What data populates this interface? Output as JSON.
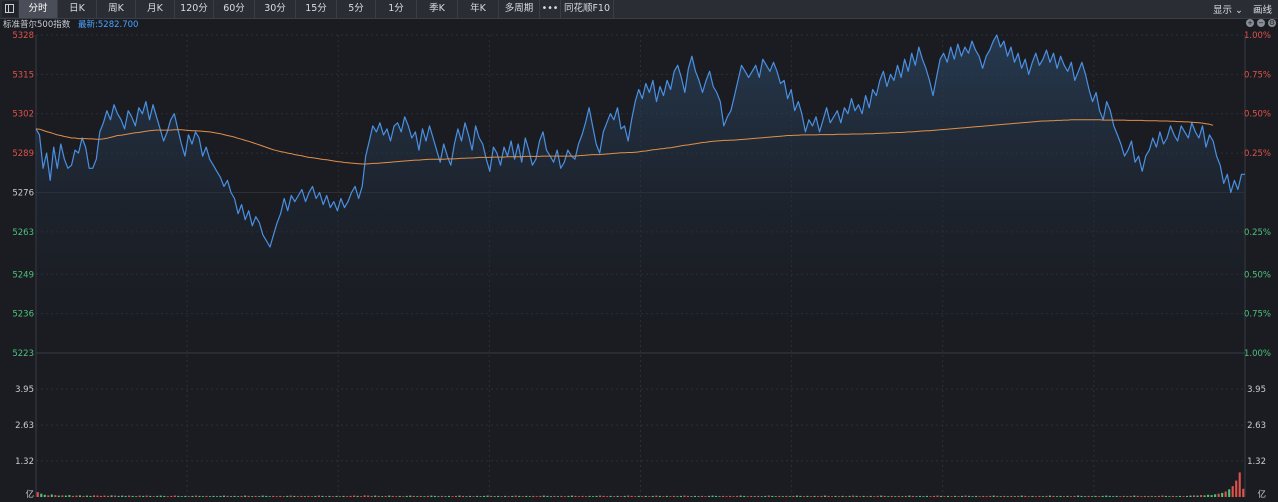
{
  "toolbar": {
    "tabs": [
      "分时",
      "日K",
      "周K",
      "月K",
      "120分",
      "60分",
      "30分",
      "15分",
      "5分",
      "1分",
      "季K",
      "年K",
      "多周期",
      "•••",
      "同花顺F10"
    ],
    "active_tab": "分时",
    "display_label": "显示",
    "draw_label": "画线"
  },
  "info": {
    "index_name": "标准普尔500指数",
    "latest_label": "最新:",
    "latest_value": "5282.700"
  },
  "colors": {
    "price_line": "#4a90e2",
    "avg_line": "#e0904a",
    "up": "#e0524a",
    "down": "#4ec27a",
    "background": "#1a1c22",
    "grid": "#2c2f36"
  },
  "chart_data": {
    "type": "line",
    "price_axis": {
      "ticks": [
        "5328",
        "5315",
        "5302",
        "5289",
        "5276",
        "5263",
        "5249",
        "5236",
        "5223"
      ],
      "pct_ticks": [
        "1.00%",
        "0.75%",
        "0.50%",
        "0.25%",
        "",
        "0.25%",
        "0.50%",
        "0.75%",
        "1.00%"
      ],
      "ylim": [
        5223,
        5328
      ],
      "reference": 5276
    },
    "volume_axis": {
      "ticks": [
        "3.95",
        "2.63",
        "1.32",
        "亿"
      ],
      "unit": "亿",
      "ylim": [
        0,
        5.27
      ]
    },
    "series": [
      {
        "values": [
          5297,
          5295,
          5284,
          5289,
          5280,
          5291,
          5284,
          5292,
          5287,
          5284,
          5285,
          5290,
          5289,
          5294,
          5291,
          5284,
          5284,
          5287,
          5296,
          5299,
          5303,
          5300,
          5305,
          5302,
          5300,
          5297,
          5303,
          5301,
          5298,
          5304,
          5302,
          5306,
          5300,
          5305,
          5301,
          5297,
          5293,
          5296,
          5300,
          5302,
          5297,
          5292,
          5288,
          5295,
          5292,
          5296,
          5294,
          5288,
          5291,
          5287,
          5285,
          5283,
          5281,
          5278,
          5280,
          5276,
          5274,
          5269,
          5272,
          5267,
          5270,
          5265,
          5268,
          5266,
          5262,
          5260,
          5258,
          5262,
          5266,
          5269,
          5274,
          5270,
          5275,
          5273,
          5275,
          5277,
          5273,
          5276,
          5278,
          5274,
          5276,
          5272,
          5275,
          5271,
          5273,
          5270,
          5274,
          5271,
          5273,
          5276,
          5278,
          5274,
          5278,
          5288,
          5293,
          5298,
          5296,
          5299,
          5295,
          5297,
          5293,
          5298,
          5299,
          5296,
          5301,
          5298,
          5294,
          5296,
          5290,
          5297,
          5293,
          5298,
          5294,
          5290,
          5286,
          5292,
          5288,
          5285,
          5292,
          5297,
          5293,
          5299,
          5295,
          5290,
          5298,
          5294,
          5292,
          5287,
          5283,
          5291,
          5289,
          5285,
          5291,
          5288,
          5293,
          5287,
          5292,
          5286,
          5294,
          5290,
          5285,
          5287,
          5293,
          5296,
          5290,
          5288,
          5286,
          5290,
          5284,
          5286,
          5290,
          5288,
          5287,
          5292,
          5295,
          5299,
          5304,
          5298,
          5292,
          5289,
          5296,
          5299,
          5302,
          5300,
          5304,
          5297,
          5298,
          5293,
          5300,
          5306,
          5310,
          5307,
          5312,
          5309,
          5313,
          5306,
          5311,
          5308,
          5313,
          5310,
          5316,
          5318,
          5314,
          5309,
          5317,
          5321,
          5316,
          5313,
          5309,
          5313,
          5316,
          5311,
          5309,
          5306,
          5298,
          5301,
          5303,
          5308,
          5313,
          5318,
          5316,
          5314,
          5316,
          5318,
          5314,
          5320,
          5318,
          5316,
          5319,
          5316,
          5312,
          5313,
          5307,
          5310,
          5303,
          5306,
          5302,
          5296,
          5300,
          5298,
          5301,
          5296,
          5300,
          5304,
          5299,
          5301,
          5303,
          5299,
          5304,
          5302,
          5307,
          5303,
          5305,
          5302,
          5308,
          5304,
          5310,
          5308,
          5313,
          5316,
          5311,
          5315,
          5313,
          5318,
          5314,
          5320,
          5316,
          5322,
          5318,
          5324,
          5320,
          5317,
          5313,
          5308,
          5314,
          5320,
          5322,
          5319,
          5324,
          5320,
          5325,
          5321,
          5324,
          5322,
          5326,
          5323,
          5321,
          5317,
          5321,
          5323,
          5326,
          5328,
          5324,
          5326,
          5321,
          5324,
          5319,
          5322,
          5317,
          5320,
          5315,
          5319,
          5322,
          5318,
          5320,
          5323,
          5319,
          5322,
          5317,
          5321,
          5318,
          5316,
          5319,
          5313,
          5316,
          5319,
          5315,
          5310,
          5306,
          5309,
          5303,
          5300,
          5306,
          5303,
          5298,
          5295,
          5292,
          5288,
          5290,
          5293,
          5286,
          5288,
          5283,
          5288,
          5290,
          5294,
          5291,
          5296,
          5292,
          5294,
          5298,
          5295,
          5293,
          5298,
          5296,
          5294,
          5299,
          5296,
          5294,
          5298,
          5291,
          5295,
          5293,
          5288,
          5285,
          5279,
          5282,
          5276,
          5280,
          5277,
          5282,
          5282
        ]
      },
      {
        "values": [
          5297.0,
          5296.9,
          5296.5,
          5296.1,
          5295.8,
          5295.4,
          5295.0,
          5294.8,
          5294.5,
          5294.3,
          5294.0,
          5294.0,
          5293.8,
          5293.8,
          5293.8,
          5293.7,
          5293.7,
          5293.6,
          5293.6,
          5293.7,
          5293.9,
          5294.2,
          5294.5,
          5294.8,
          5294.9,
          5295.1,
          5295.3,
          5295.5,
          5295.7,
          5295.8,
          5296.0,
          5296.2,
          5296.4,
          5296.5,
          5296.6,
          5296.6,
          5296.6,
          5296.6,
          5296.6,
          5296.7,
          5296.7,
          5296.7,
          5296.6,
          5296.5,
          5296.4,
          5296.4,
          5296.3,
          5296.2,
          5296.1,
          5296.0,
          5295.8,
          5295.6,
          5295.4,
          5295.1,
          5294.8,
          5294.6,
          5294.3,
          5293.9,
          5293.6,
          5293.2,
          5292.9,
          5292.5,
          5292.1,
          5291.7,
          5291.3,
          5290.9,
          5290.5,
          5290.1,
          5289.8,
          5289.5,
          5289.3,
          5289.0,
          5288.8,
          5288.5,
          5288.3,
          5288.1,
          5287.8,
          5287.6,
          5287.5,
          5287.3,
          5287.1,
          5286.9,
          5286.8,
          5286.6,
          5286.4,
          5286.2,
          5286.1,
          5285.9,
          5285.8,
          5285.7,
          5285.6,
          5285.5,
          5285.4,
          5285.4,
          5285.5,
          5285.6,
          5285.6,
          5285.7,
          5285.8,
          5285.9,
          5286.0,
          5286.1,
          5286.2,
          5286.3,
          5286.4,
          5286.5,
          5286.6,
          5286.7,
          5286.7,
          5286.8,
          5286.9,
          5287.0,
          5287.0,
          5287.0,
          5287.0,
          5287.0,
          5287.1,
          5287.1,
          5287.1,
          5287.2,
          5287.3,
          5287.3,
          5287.4,
          5287.4,
          5287.5,
          5287.6,
          5287.6,
          5287.6,
          5287.6,
          5287.7,
          5287.7,
          5287.7,
          5287.7,
          5287.8,
          5287.8,
          5287.8,
          5287.8,
          5287.8,
          5287.9,
          5287.9,
          5287.9,
          5287.9,
          5287.9,
          5288.0,
          5288.0,
          5288.0,
          5288.0,
          5288.0,
          5288.0,
          5288.0,
          5288.0,
          5288.0,
          5288.0,
          5288.1,
          5288.2,
          5288.3,
          5288.4,
          5288.5,
          5288.5,
          5288.5,
          5288.6,
          5288.7,
          5288.8,
          5288.9,
          5289.0,
          5289.1,
          5289.1,
          5289.2,
          5289.2,
          5289.3,
          5289.4,
          5289.6,
          5289.7,
          5289.9,
          5290.1,
          5290.2,
          5290.4,
          5290.5,
          5290.7,
          5290.8,
          5291.0,
          5291.2,
          5291.4,
          5291.6,
          5291.7,
          5291.9,
          5292.1,
          5292.3,
          5292.5,
          5292.6,
          5292.8,
          5292.9,
          5293.0,
          5293.1,
          5293.2,
          5293.2,
          5293.3,
          5293.3,
          5293.4,
          5293.5,
          5293.6,
          5293.7,
          5293.8,
          5293.9,
          5294.0,
          5294.1,
          5294.2,
          5294.3,
          5294.4,
          5294.5,
          5294.6,
          5294.7,
          5294.8,
          5294.8,
          5294.9,
          5294.9,
          5295.0,
          5295.0,
          5295.0,
          5295.0,
          5295.0,
          5295.1,
          5295.1,
          5295.1,
          5295.1,
          5295.1,
          5295.2,
          5295.2,
          5295.2,
          5295.2,
          5295.3,
          5295.3,
          5295.3,
          5295.3,
          5295.4,
          5295.4,
          5295.4,
          5295.5,
          5295.5,
          5295.6,
          5295.6,
          5295.7,
          5295.7,
          5295.8,
          5295.8,
          5295.9,
          5296.0,
          5296.0,
          5296.1,
          5296.2,
          5296.3,
          5296.4,
          5296.4,
          5296.5,
          5296.6,
          5296.7,
          5296.8,
          5296.9,
          5297.0,
          5297.1,
          5297.2,
          5297.3,
          5297.4,
          5297.5,
          5297.6,
          5297.7,
          5297.8,
          5297.9,
          5298.0,
          5298.1,
          5298.2,
          5298.3,
          5298.4,
          5298.5,
          5298.6,
          5298.7,
          5298.8,
          5298.9,
          5299.0,
          5299.1,
          5299.2,
          5299.3,
          5299.4,
          5299.5,
          5299.6,
          5299.6,
          5299.7,
          5299.7,
          5299.8,
          5299.8,
          5299.9,
          5299.9,
          5300.0,
          5300.0,
          5300.0,
          5300.0,
          5300.0,
          5300.0,
          5300.0,
          5300.0,
          5300.0,
          5299.9,
          5299.9,
          5299.9,
          5299.9,
          5299.9,
          5299.9,
          5299.9,
          5299.8,
          5299.8,
          5299.8,
          5299.8,
          5299.8,
          5299.7,
          5299.7,
          5299.7,
          5299.7,
          5299.6,
          5299.6,
          5299.6,
          5299.5,
          5299.5,
          5299.4,
          5299.4,
          5299.3,
          5299.3,
          5299.2,
          5299.1,
          5299.0,
          5298.9,
          5298.7,
          5298.5,
          5298.2
        ]
      }
    ],
    "volume": [
      0.18,
      0.12,
      0.08,
      0.06,
      0.09,
      0.07,
      0.05,
      0.06,
      0.05,
      0.07,
      0.04,
      0.05,
      0.06,
      0.04,
      0.05,
      0.04,
      0.06,
      0.05,
      0.04,
      0.05,
      0.04,
      0.06,
      0.05,
      0.04,
      0.05,
      0.04,
      0.05,
      0.04,
      0.03,
      0.05,
      0.04,
      0.05,
      0.04,
      0.03,
      0.04,
      0.05,
      0.04,
      0.03,
      0.04,
      0.05,
      0.04,
      0.03,
      0.04,
      0.03,
      0.04,
      0.05,
      0.04,
      0.03,
      0.04,
      0.03,
      0.04,
      0.03,
      0.04,
      0.05,
      0.04,
      0.03,
      0.04,
      0.03,
      0.04,
      0.05,
      0.04,
      0.03,
      0.04,
      0.03,
      0.05,
      0.04,
      0.03,
      0.04,
      0.03,
      0.04,
      0.03,
      0.04,
      0.05,
      0.04,
      0.03,
      0.04,
      0.03,
      0.04,
      0.03,
      0.04,
      0.05,
      0.04,
      0.03,
      0.04,
      0.03,
      0.04,
      0.03,
      0.04,
      0.03,
      0.04,
      0.05,
      0.04,
      0.03,
      0.06,
      0.05,
      0.04,
      0.05,
      0.04,
      0.03,
      0.04,
      0.05,
      0.04,
      0.03,
      0.04,
      0.03,
      0.04,
      0.05,
      0.04,
      0.03,
      0.04,
      0.03,
      0.04,
      0.05,
      0.04,
      0.03,
      0.04,
      0.03,
      0.04,
      0.03,
      0.04,
      0.05,
      0.04,
      0.03,
      0.04,
      0.03,
      0.04,
      0.03,
      0.04,
      0.05,
      0.04,
      0.03,
      0.04,
      0.03,
      0.04,
      0.03,
      0.04,
      0.05,
      0.04,
      0.03,
      0.04,
      0.03,
      0.04,
      0.03,
      0.04,
      0.05,
      0.04,
      0.03,
      0.04,
      0.03,
      0.04,
      0.03,
      0.04,
      0.05,
      0.04,
      0.03,
      0.04,
      0.03,
      0.04,
      0.03,
      0.04,
      0.05,
      0.04,
      0.03,
      0.04,
      0.03,
      0.04,
      0.03,
      0.04,
      0.05,
      0.04,
      0.03,
      0.04,
      0.03,
      0.04,
      0.03,
      0.04,
      0.05,
      0.04,
      0.03,
      0.04,
      0.03,
      0.04,
      0.03,
      0.04,
      0.05,
      0.04,
      0.03,
      0.04,
      0.03,
      0.04,
      0.03,
      0.04,
      0.05,
      0.04,
      0.03,
      0.04,
      0.03,
      0.04,
      0.03,
      0.04,
      0.05,
      0.04,
      0.03,
      0.04,
      0.03,
      0.04,
      0.03,
      0.04,
      0.05,
      0.04,
      0.03,
      0.04,
      0.03,
      0.04,
      0.03,
      0.04,
      0.05,
      0.04,
      0.03,
      0.04,
      0.03,
      0.04,
      0.03,
      0.04,
      0.05,
      0.04,
      0.03,
      0.04,
      0.03,
      0.04,
      0.03,
      0.04,
      0.05,
      0.04,
      0.03,
      0.04,
      0.03,
      0.04,
      0.03,
      0.04,
      0.05,
      0.04,
      0.03,
      0.04,
      0.03,
      0.04,
      0.03,
      0.04,
      0.05,
      0.04,
      0.03,
      0.04,
      0.03,
      0.04,
      0.03,
      0.04,
      0.05,
      0.04,
      0.03,
      0.04,
      0.03,
      0.04,
      0.03,
      0.04,
      0.05,
      0.04,
      0.03,
      0.04,
      0.03,
      0.04,
      0.03,
      0.04,
      0.05,
      0.04,
      0.03,
      0.04,
      0.03,
      0.04,
      0.03,
      0.04,
      0.05,
      0.04,
      0.03,
      0.04,
      0.03,
      0.04,
      0.03,
      0.04,
      0.05,
      0.04,
      0.03,
      0.04,
      0.03,
      0.04,
      0.03,
      0.04,
      0.05,
      0.04,
      0.03,
      0.04,
      0.03,
      0.04,
      0.03,
      0.04,
      0.05,
      0.04,
      0.03,
      0.04,
      0.03,
      0.04,
      0.03,
      0.04,
      0.05,
      0.04,
      0.03,
      0.04,
      0.03,
      0.04,
      0.03,
      0.04,
      0.05,
      0.04,
      0.03,
      0.04,
      0.03,
      0.04,
      0.03,
      0.04,
      0.05,
      0.06,
      0.05,
      0.07,
      0.06,
      0.08,
      0.07,
      0.1,
      0.12,
      0.15,
      0.2,
      0.28,
      0.4,
      0.6,
      0.9,
      0.3
    ]
  }
}
